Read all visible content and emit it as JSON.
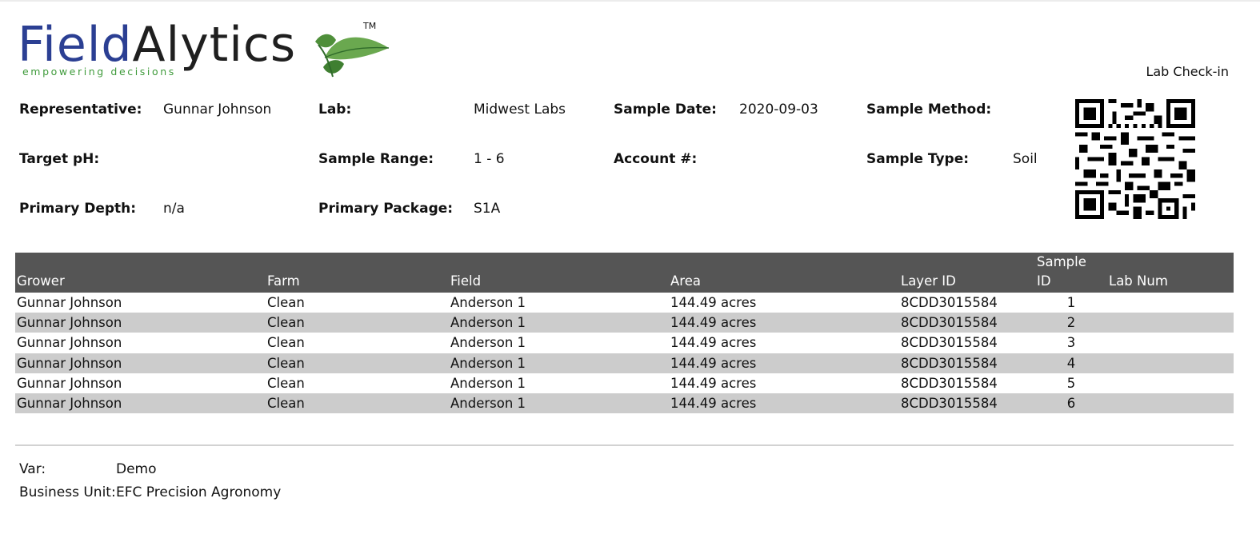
{
  "logo": {
    "name_part1": "Field",
    "name_part2": "Alytics",
    "tagline": "empowering decisions",
    "trademark": "TM",
    "colors": {
      "blue": "#2b3f93",
      "green": "#3e9a3a",
      "dark": "#1f1f1f"
    }
  },
  "header": {
    "title": "Lab Check-in"
  },
  "info": {
    "representative": {
      "label": "Representative:",
      "value": "Gunnar Johnson"
    },
    "lab": {
      "label": "Lab:",
      "value": "Midwest Labs"
    },
    "sample_date": {
      "label": "Sample Date:",
      "value": "2020-09-03"
    },
    "sample_method": {
      "label": "Sample Method:",
      "value": ""
    },
    "target_ph": {
      "label": "Target pH:",
      "value": ""
    },
    "sample_range": {
      "label": "Sample Range:",
      "value": "1 - 6"
    },
    "account": {
      "label": "Account #:",
      "value": ""
    },
    "sample_type": {
      "label": "Sample Type:",
      "value": "Soil"
    },
    "primary_depth": {
      "label": "Primary Depth:",
      "value": "n/a"
    },
    "primary_package": {
      "label": "Primary Package:",
      "value": "S1A"
    }
  },
  "table": {
    "headers": {
      "grower": "Grower",
      "farm": "Farm",
      "field": "Field",
      "area": "Area",
      "layer_id": "Layer ID",
      "sample_id_line1": "Sample",
      "sample_id_line2": "ID",
      "lab_num": "Lab Num"
    },
    "rows": [
      {
        "grower": "Gunnar Johnson",
        "farm": "Clean",
        "field": "Anderson 1",
        "area": "144.49 acres",
        "layer_id": "8CDD3015584",
        "sample_id": "1",
        "lab_num": ""
      },
      {
        "grower": "Gunnar Johnson",
        "farm": "Clean",
        "field": "Anderson 1",
        "area": "144.49 acres",
        "layer_id": "8CDD3015584",
        "sample_id": "2",
        "lab_num": ""
      },
      {
        "grower": "Gunnar Johnson",
        "farm": "Clean",
        "field": "Anderson 1",
        "area": "144.49 acres",
        "layer_id": "8CDD3015584",
        "sample_id": "3",
        "lab_num": ""
      },
      {
        "grower": "Gunnar Johnson",
        "farm": "Clean",
        "field": "Anderson 1",
        "area": "144.49 acres",
        "layer_id": "8CDD3015584",
        "sample_id": "4",
        "lab_num": ""
      },
      {
        "grower": "Gunnar Johnson",
        "farm": "Clean",
        "field": "Anderson 1",
        "area": "144.49 acres",
        "layer_id": "8CDD3015584",
        "sample_id": "5",
        "lab_num": ""
      },
      {
        "grower": "Gunnar Johnson",
        "farm": "Clean",
        "field": "Anderson 1",
        "area": "144.49 acres",
        "layer_id": "8CDD3015584",
        "sample_id": "6",
        "lab_num": ""
      }
    ],
    "colors": {
      "header_bg": "#555555",
      "alt_row_bg": "#cccccc"
    }
  },
  "footer": {
    "var": {
      "label": "Var:",
      "value": "Demo"
    },
    "business_unit": {
      "label": "Business Unit:",
      "value": "EFC Precision Agronomy"
    }
  },
  "qr": {
    "icon": "qr-code-icon"
  }
}
